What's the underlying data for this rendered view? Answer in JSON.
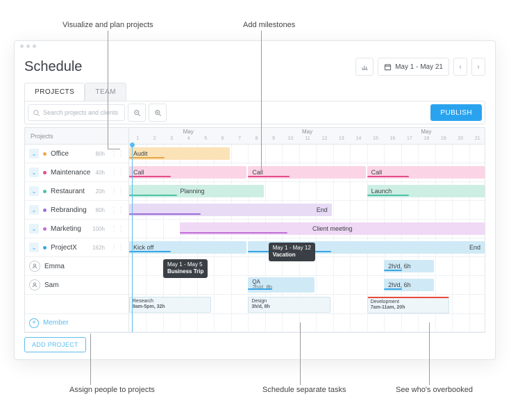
{
  "annotations": {
    "top_left": "Visualize and plan projects",
    "top_right": "Add milestones",
    "bottom_left": "Assign people to projects",
    "bottom_mid": "Schedule separate tasks",
    "bottom_right": "See who's overbooked"
  },
  "header": {
    "title": "Schedule",
    "date_range": "May 1 - May 21",
    "publish": "PUBLISH"
  },
  "tabs": {
    "projects": "PROJECTS",
    "team": "TEAM"
  },
  "toolbar": {
    "search_placeholder": "Search projects and clients"
  },
  "sidebar": {
    "header": "Projects",
    "rows": [
      {
        "name": "Office",
        "hours": "80h",
        "color": "#f0a84a"
      },
      {
        "name": "Maintenance",
        "hours": "40h",
        "color": "#e64c8a"
      },
      {
        "name": "Restaurant",
        "hours": "20h",
        "color": "#4fc1a6"
      },
      {
        "name": "Rebranding",
        "hours": "80h",
        "color": "#9b6fd6"
      },
      {
        "name": "Marketing",
        "hours": "100h",
        "color": "#c06fd6"
      },
      {
        "name": "ProjectX",
        "hours": "162h",
        "color": "#3aa5e5"
      }
    ],
    "people": [
      {
        "name": "Emma"
      },
      {
        "name": "Sam"
      }
    ],
    "member_link": "Member",
    "add_project": "ADD PROJECT"
  },
  "timeline": {
    "month_label": "May",
    "days": [
      1,
      2,
      3,
      4,
      5,
      6,
      7,
      8,
      9,
      10,
      11,
      12,
      13,
      14,
      15,
      16,
      17,
      18,
      19,
      20,
      21
    ],
    "weekends": [
      [
        6,
        7
      ],
      [
        13,
        14
      ],
      [
        20,
        21
      ]
    ],
    "today": 1
  },
  "bars": {
    "office": [
      {
        "label": "Audit",
        "start": 1,
        "end": 6,
        "bg": "#fbe3b7",
        "line": "#e7a64a"
      }
    ],
    "maintenance": [
      {
        "label": "Call",
        "start": 1,
        "end": 7,
        "bg": "#fbd5e5",
        "line": "#e64c8a"
      },
      {
        "label": "Call",
        "start": 8,
        "end": 14,
        "bg": "#fbd5e5",
        "line": "#e64c8a"
      },
      {
        "label": "Call",
        "start": 15,
        "end": 21,
        "bg": "#fbd5e5",
        "line": "#e64c8a"
      }
    ],
    "restaurant": [
      {
        "label": "Planning",
        "start": 1,
        "end": 8,
        "bg": "#cdeee3",
        "line": "#4fc1a6",
        "text_offset": 3
      },
      {
        "label": "Launch",
        "start": 15,
        "end": 21,
        "bg": "#cdeee3",
        "line": "#4fc1a6"
      }
    ],
    "rebranding": [
      {
        "label": "End",
        "start": 1,
        "end": 12,
        "bg": "#e7dbf5",
        "line": "#9b6fd6",
        "text_right": true
      }
    ],
    "marketing": [
      {
        "label": "Client meeting",
        "start": 4,
        "end": 21,
        "bg": "#f0d9f5",
        "line": "#c06fd6",
        "text_center": true
      }
    ],
    "projectx": [
      {
        "label": "Kick off",
        "start": 1,
        "end": 7,
        "bg": "#cfeaf6",
        "line": "#3aa5e5"
      },
      {
        "label": "End",
        "start": 8,
        "end": 21,
        "bg": "#cfeaf6",
        "line": "#3aa5e5",
        "text_right": true
      }
    ],
    "emma": [
      {
        "label": "2h/d, 6h",
        "start": 16,
        "end": 18,
        "bg": "#cfeaf6",
        "line": "#3aa5e5"
      }
    ],
    "sam": [
      {
        "label": "QA",
        "sub": "2h/d, 8h",
        "start": 8,
        "end": 11,
        "bg": "#cfeaf6",
        "line": "#3aa5e5"
      },
      {
        "label": "2h/d, 6h",
        "start": 16,
        "end": 18,
        "bg": "#cfeaf6",
        "line": "#3aa5e5"
      }
    ]
  },
  "tooltips": {
    "business_trip": {
      "range": "May 1 - May 5",
      "title": "Business Trip"
    },
    "vacation": {
      "range": "May 1 - May 12",
      "title": "Vacation"
    }
  },
  "tasks": [
    {
      "name": "Research",
      "detail": "9am-5pm, 32h",
      "start": 1,
      "end": 5
    },
    {
      "name": "Design",
      "detail": "3h/d, 8h",
      "start": 8,
      "end": 12
    },
    {
      "name": "Development",
      "detail": "7am-11am, 20h",
      "start": 15,
      "end": 19,
      "overbooked": true
    }
  ]
}
